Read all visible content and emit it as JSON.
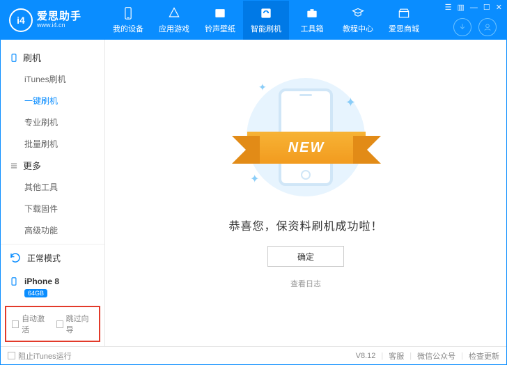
{
  "app": {
    "name": "爱思助手",
    "subtitle": "www.i4.cn",
    "logo_text": "i4"
  },
  "nav": {
    "items": [
      {
        "label": "我的设备"
      },
      {
        "label": "应用游戏"
      },
      {
        "label": "铃声壁纸"
      },
      {
        "label": "智能刷机"
      },
      {
        "label": "工具箱"
      },
      {
        "label": "教程中心"
      },
      {
        "label": "爱思商城"
      }
    ],
    "active_index": 3
  },
  "sidebar": {
    "sections": [
      {
        "title": "刷机",
        "items": [
          "iTunes刷机",
          "一键刷机",
          "专业刷机",
          "批量刷机"
        ],
        "selected_index": 1
      },
      {
        "title": "更多",
        "items": [
          "其他工具",
          "下载固件",
          "高级功能"
        ],
        "selected_index": -1
      }
    ],
    "mode_label": "正常模式",
    "device_name": "iPhone 8",
    "device_capacity": "64GB",
    "auto_activate_label": "自动激活",
    "skip_wizard_label": "跳过向导"
  },
  "content": {
    "ribbon_text": "NEW",
    "success_msg": "恭喜您，保资料刷机成功啦！",
    "ok_label": "确定",
    "log_label": "查看日志"
  },
  "statusbar": {
    "block_itunes_label": "阻止iTunes运行",
    "version": "V8.12",
    "items": [
      "客服",
      "微信公众号",
      "检查更新"
    ]
  }
}
